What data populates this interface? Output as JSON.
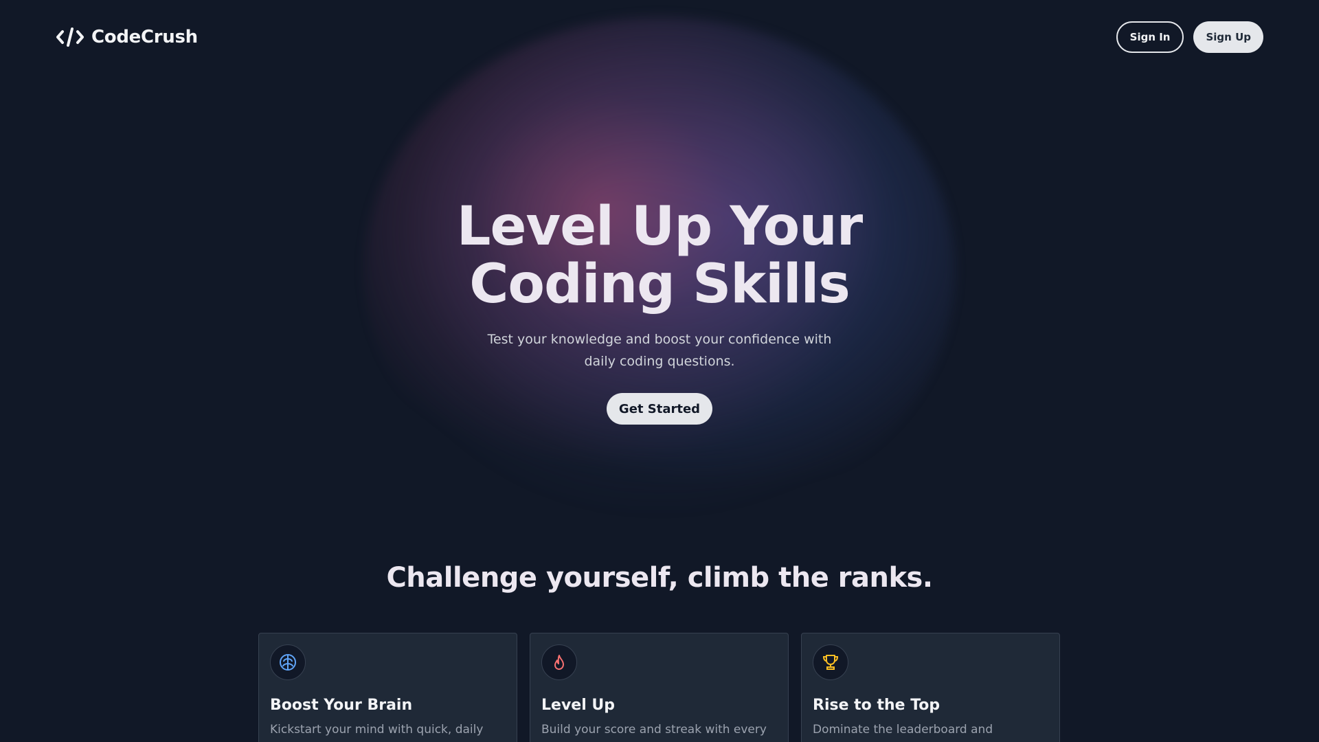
{
  "app": {
    "name": "CodeCrush",
    "logo_icon": "code-brackets-icon"
  },
  "header": {
    "sign_in_label": "Sign In",
    "sign_up_label": "Sign Up"
  },
  "hero": {
    "title": "Level Up Your Coding Skills",
    "subtitle": "Test your knowledge and boost your confidence with daily coding questions.",
    "cta_label": "Get Started"
  },
  "features": {
    "heading": "Challenge yourself, climb the ranks.",
    "cards": [
      {
        "icon": "brain-icon",
        "icon_color": "#60a5fa",
        "title": "Boost Your Brain",
        "text": "Kickstart your mind with quick, daily"
      },
      {
        "icon": "flame-icon",
        "icon_color": "#f87171",
        "title": "Level Up",
        "text": "Build your score and streak with every"
      },
      {
        "icon": "trophy-icon",
        "icon_color": "#fbbf24",
        "title": "Rise to the Top",
        "text": "Dominate the leaderboard and showcase"
      }
    ]
  },
  "colors": {
    "background": "#111827",
    "card_background": "#1f2937",
    "button_light": "#e5e7eb"
  }
}
